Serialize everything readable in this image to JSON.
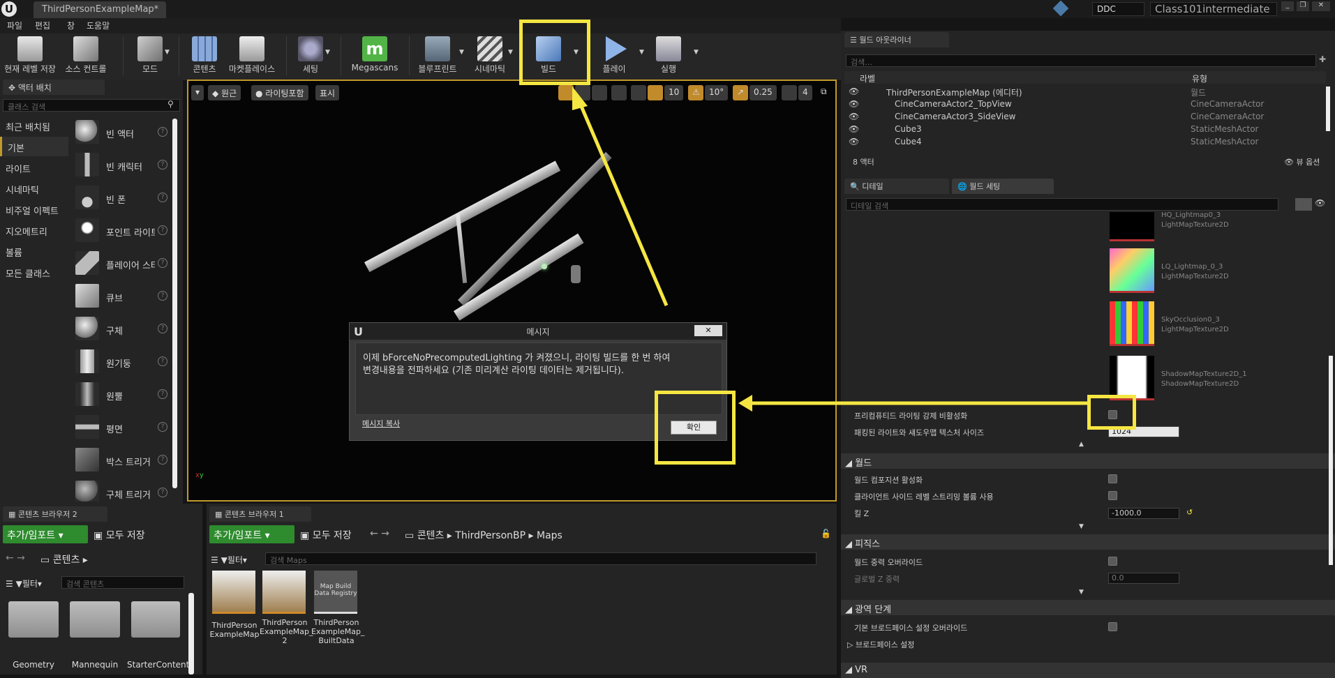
{
  "app": {
    "tab_title": "ThirdPersonExampleMap*",
    "ddc": "DDC",
    "project": "Class101intermediate"
  },
  "menu": [
    "파일",
    "편집",
    "창",
    "도움말"
  ],
  "toolbar": {
    "save": "현재 레벨 저장",
    "source": "소스 컨트롤",
    "modes": "모드",
    "content": "콘텐츠",
    "marketplace": "마켓플레이스",
    "settings": "세팅",
    "megascans": "Megascans",
    "blueprints": "블루프린트",
    "cinematics": "시네마틱",
    "build": "빌드",
    "play": "플레이",
    "launch": "실행"
  },
  "placement": {
    "tab": "액터 배치",
    "search_placeholder": "클래스 검색",
    "categories": [
      "최근 배치됨",
      "기본",
      "라이트",
      "시네마틱",
      "비주얼 이펙트",
      "지오메트리",
      "볼륨",
      "모든 클래스"
    ],
    "items": [
      "빈 액터",
      "빈 캐릭터",
      "빈 폰",
      "포인트 라이트",
      "플레이어 스타트",
      "큐브",
      "구체",
      "원기둥",
      "원뿔",
      "평면",
      "박스 트리거",
      "구체 트리거"
    ]
  },
  "viewport": {
    "perspective": "원근",
    "lit": "라이팅포함",
    "show": "표시",
    "grid": "10",
    "angle": "10°",
    "scale": "0.25",
    "speed": "4"
  },
  "dialog": {
    "title": "메시지",
    "line1": "이제 bForceNoPrecomputedLighting 가 켜졌으니, 라이팅 빌드를 한 번 하여",
    "line2": "변경내용을 전파하세요 (기존 미리계산 라이팅 데이터는 제거됩니다).",
    "copy": "메시지 복사",
    "ok": "확인"
  },
  "cb2": {
    "tab": "콘텐츠 브라우저 2",
    "add": "추가/임포트",
    "save_all": "모두 저장",
    "path": "콘텐츠",
    "filter": "필터",
    "search_placeholder": "검색 콘텐츠",
    "folders": [
      "Geometry",
      "Mannequin",
      "StarterContent"
    ]
  },
  "cb1": {
    "tab": "콘텐츠 브라우저 1",
    "add": "추가/임포트",
    "save_all": "모두 저장",
    "path": [
      "콘텐츠",
      "ThirdPersonBP",
      "Maps"
    ],
    "filter": "필터",
    "search_placeholder": "검색 Maps",
    "assets": [
      {
        "name": "ThirdPerson ExampleMap",
        "thumb": "Map"
      },
      {
        "name": "ThirdPerson ExampleMap_ 2",
        "thumb": "Map"
      },
      {
        "name": "ThirdPerson ExampleMap_ BuiltData",
        "thumb": "Map Build Data Registry"
      }
    ]
  },
  "outliner": {
    "tab": "월드 아웃라이너",
    "search_placeholder": "검색...",
    "col_label": "라벨",
    "col_type": "유형",
    "rows": [
      {
        "name": "ThirdPersonExampleMap (에디터)",
        "type": "월드"
      },
      {
        "name": "CineCameraActor2_TopView",
        "type": "CineCameraActor"
      },
      {
        "name": "CineCameraActor3_SideView",
        "type": "CineCameraActor"
      },
      {
        "name": "Cube3",
        "type": "StaticMeshActor"
      },
      {
        "name": "Cube4",
        "type": "StaticMeshActor"
      }
    ],
    "count": "8 액터",
    "view_options": "뷰 옵션"
  },
  "details": {
    "tab_details": "디테일",
    "tab_world": "월드 세팅",
    "search_placeholder": "디테일 검색",
    "textures": [
      {
        "name": "HQ_Lightmap0_3",
        "type": "LightMapTexture2D"
      },
      {
        "name": "LQ_Lightmap_0_3",
        "type": "LightMapTexture2D"
      },
      {
        "name": "SkyOcclusion0_3",
        "type": "LightMapTexture2D"
      },
      {
        "name": "ShadowMapTexture2D_1",
        "type": "ShadowMapTexture2D"
      }
    ],
    "force_no_precomputed": "프리컴퓨티드 라이팅 강제 비활성화",
    "packed_size_label": "패킹된 라이트와 섀도우맵 텍스처 사이즈",
    "packed_size_value": "1024",
    "world_section": "월드",
    "world_comp": "월드 컴포지션 활성화",
    "client_streaming": "클라이언트 사이드 레벨 스트리밍 볼륨 사용",
    "kill_z": "킬 Z",
    "kill_z_value": "-1000.0",
    "physics_section": "피직스",
    "gravity_override": "월드 중력 오버라이드",
    "global_gravity": "글로벌 Z 중력",
    "global_gravity_value": "0.0",
    "broadphase_section": "광역 단계",
    "broadphase_override": "기본 브로드페이스 설정 오버라이드",
    "broadphase_settings": "브로드페이스 설정",
    "vr_section": "VR"
  },
  "colors": {
    "highlight": "#f5e642",
    "accent": "#c19a2b",
    "green": "#2e8b2e"
  }
}
